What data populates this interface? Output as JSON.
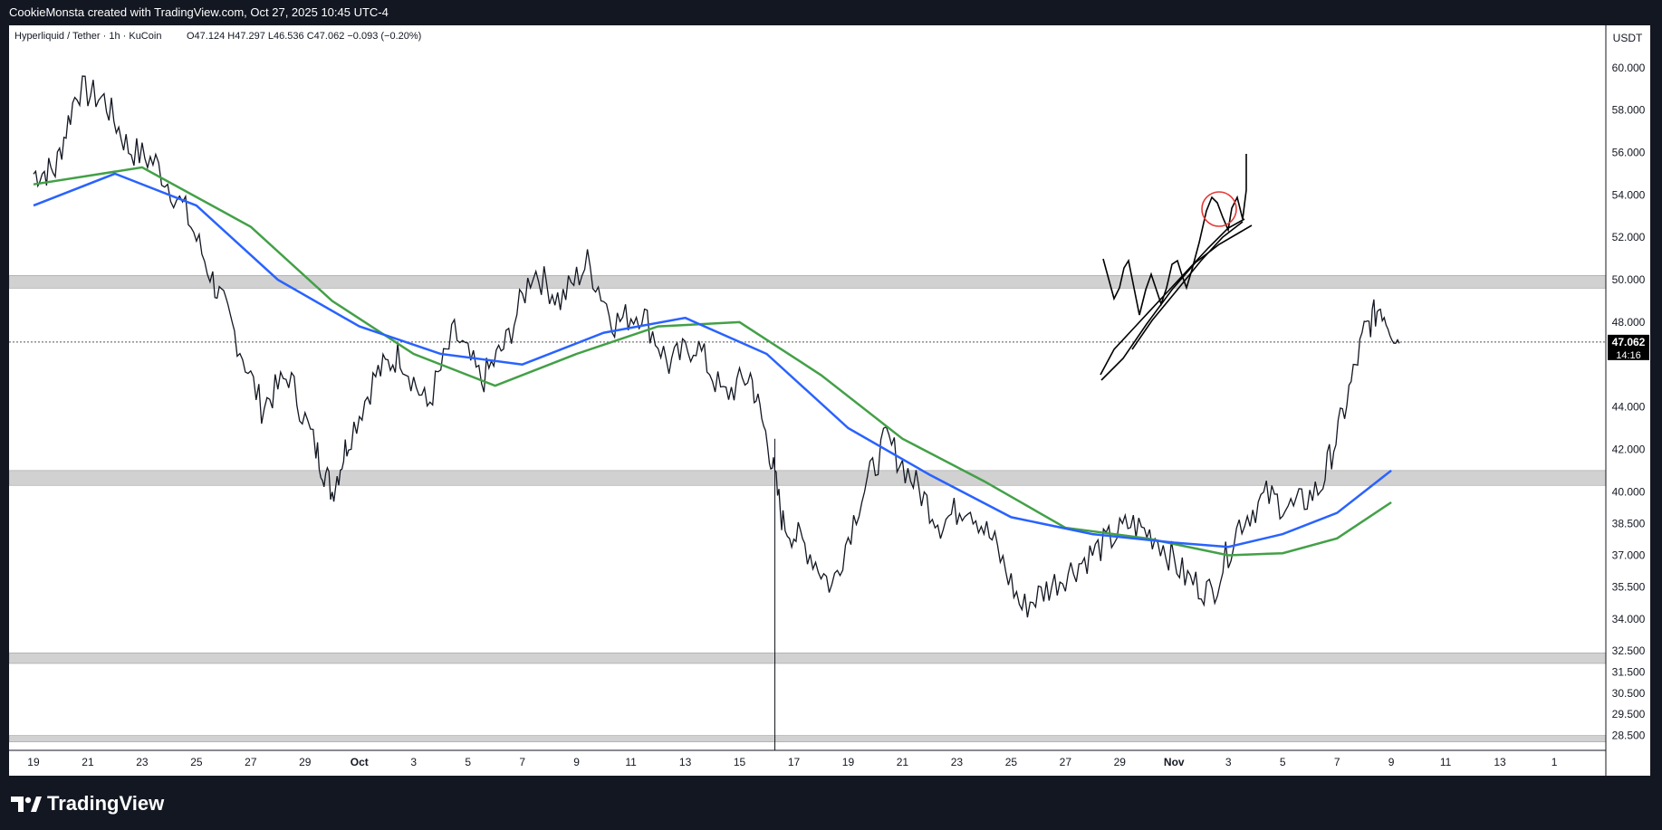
{
  "header": {
    "attribution": "CookieMonsta created with TradingView.com, Oct 27, 2025 10:45 UTC-4"
  },
  "legend": {
    "symbol": "Hyperliquid / Tether · 1h · KuCoin",
    "ohlc": "O47.124  H47.297  L46.536  C47.062  −0.093 (−0.20%)"
  },
  "currency_label": "USDT",
  "footer": {
    "brand": "TradingView"
  },
  "current_price": {
    "value": "47.062",
    "countdown": "14:16",
    "price": 47.062
  },
  "colors": {
    "background": "#ffffff",
    "frame": "#131722",
    "candle": "#131722",
    "ma_fast": "#2962ff",
    "ma_slow": "#43a047",
    "zone": "#d1d1d1",
    "highlight_circle": "#e53935",
    "projection": "#000000"
  },
  "chart_data": {
    "type": "line",
    "xlabels": [
      "19",
      "21",
      "23",
      "25",
      "27",
      "29",
      "Oct",
      "3",
      "5",
      "7",
      "9",
      "11",
      "13",
      "15",
      "17",
      "19",
      "21",
      "23",
      "25",
      "27",
      "29",
      "Nov",
      "3",
      "5",
      "7",
      "9",
      "11",
      "13",
      "1"
    ],
    "yticks": [
      "60.000",
      "58.000",
      "56.000",
      "54.000",
      "52.000",
      "50.000",
      "48.000",
      "44.000",
      "42.000",
      "40.000",
      "38.500",
      "37.000",
      "35.500",
      "34.000",
      "32.500",
      "31.500",
      "30.500",
      "29.500",
      "28.500"
    ],
    "ytick_values": [
      60,
      58,
      56,
      54,
      52,
      50,
      48,
      44,
      42,
      40,
      38.5,
      37,
      35.5,
      34,
      32.5,
      31.5,
      30.5,
      29.5,
      28.5
    ],
    "price_anchors": [
      {
        "day": 0,
        "price": 55.0
      },
      {
        "day": 0.8,
        "price": 55.2
      },
      {
        "day": 1.6,
        "price": 59.0
      },
      {
        "day": 2.6,
        "price": 58.5
      },
      {
        "day": 3.5,
        "price": 56.2
      },
      {
        "day": 4.5,
        "price": 55.5
      },
      {
        "day": 5.6,
        "price": 53.2
      },
      {
        "day": 6.6,
        "price": 50.0
      },
      {
        "day": 7.4,
        "price": 47.5
      },
      {
        "day": 8.4,
        "price": 44.0
      },
      {
        "day": 9.4,
        "price": 45.5
      },
      {
        "day": 10.4,
        "price": 42.0
      },
      {
        "day": 11.0,
        "price": 40.0
      },
      {
        "day": 11.6,
        "price": 42.5
      },
      {
        "day": 12.6,
        "price": 45.5
      },
      {
        "day": 13.5,
        "price": 46.5
      },
      {
        "day": 14.5,
        "price": 44.0
      },
      {
        "day": 15.5,
        "price": 47.5
      },
      {
        "day": 16.5,
        "price": 45.2
      },
      {
        "day": 17.4,
        "price": 47.0
      },
      {
        "day": 18.4,
        "price": 50.5
      },
      {
        "day": 19.4,
        "price": 49.0
      },
      {
        "day": 20.4,
        "price": 50.8
      },
      {
        "day": 21.4,
        "price": 48.0
      },
      {
        "day": 22.4,
        "price": 48.5
      },
      {
        "day": 23.4,
        "price": 46.0
      },
      {
        "day": 24.4,
        "price": 47.0
      },
      {
        "day": 25.4,
        "price": 44.5
      },
      {
        "day": 26.4,
        "price": 45.5
      },
      {
        "day": 27.1,
        "price": 42.0
      },
      {
        "day": 27.6,
        "price": 38.5
      },
      {
        "day": 28.4,
        "price": 37.5
      },
      {
        "day": 29.4,
        "price": 35.5
      },
      {
        "day": 30.4,
        "price": 39.5
      },
      {
        "day": 31.4,
        "price": 42.5
      },
      {
        "day": 32.4,
        "price": 40.5
      },
      {
        "day": 33.4,
        "price": 38.5
      },
      {
        "day": 34.4,
        "price": 39.5
      },
      {
        "day": 35.4,
        "price": 37.5
      },
      {
        "day": 36.4,
        "price": 34.5
      },
      {
        "day": 37.4,
        "price": 35.5
      },
      {
        "day": 38.4,
        "price": 36.5
      },
      {
        "day": 39.4,
        "price": 37.5
      },
      {
        "day": 40.4,
        "price": 38.5
      },
      {
        "day": 41.4,
        "price": 37.8
      },
      {
        "day": 42.4,
        "price": 36.0
      },
      {
        "day": 43.4,
        "price": 35.2
      },
      {
        "day": 44.4,
        "price": 38.5
      },
      {
        "day": 45.4,
        "price": 39.8
      },
      {
        "day": 46.4,
        "price": 39.2
      },
      {
        "day": 47.4,
        "price": 40.2
      },
      {
        "day": 48.2,
        "price": 43.5
      },
      {
        "day": 49.0,
        "price": 47.5
      },
      {
        "day": 49.6,
        "price": 48.8
      },
      {
        "day": 50.3,
        "price": 47.0
      }
    ],
    "ma_fast": [
      [
        0,
        53.5
      ],
      [
        3,
        55.0
      ],
      [
        6,
        53.5
      ],
      [
        9,
        50.0
      ],
      [
        12,
        47.8
      ],
      [
        15,
        46.5
      ],
      [
        18,
        46.0
      ],
      [
        21,
        47.5
      ],
      [
        24,
        48.2
      ],
      [
        27,
        46.5
      ],
      [
        30,
        43.0
      ],
      [
        33,
        40.8
      ],
      [
        36,
        38.8
      ],
      [
        39,
        38.0
      ],
      [
        42,
        37.6
      ],
      [
        44,
        37.4
      ],
      [
        46,
        38.0
      ],
      [
        48,
        39.0
      ],
      [
        50,
        41.0
      ]
    ],
    "ma_slow": [
      [
        0,
        54.5
      ],
      [
        4,
        55.3
      ],
      [
        8,
        52.5
      ],
      [
        11,
        49.0
      ],
      [
        14,
        46.5
      ],
      [
        17,
        45.0
      ],
      [
        20,
        46.5
      ],
      [
        23,
        47.8
      ],
      [
        26,
        48.0
      ],
      [
        29,
        45.5
      ],
      [
        32,
        42.5
      ],
      [
        35,
        40.5
      ],
      [
        38,
        38.3
      ],
      [
        41,
        37.8
      ],
      [
        44,
        37.0
      ],
      [
        46,
        37.1
      ],
      [
        48,
        37.8
      ],
      [
        50,
        39.5
      ]
    ],
    "ylim": [
      27.8,
      62.0
    ],
    "xlim_days": [
      -0.9,
      57.9
    ],
    "zones": [
      [
        49.6,
        50.2
      ],
      [
        40.3,
        41.0
      ],
      [
        31.9,
        32.4
      ],
      [
        28.2,
        28.5
      ]
    ],
    "legend_placement": "top-left",
    "grid": false
  }
}
